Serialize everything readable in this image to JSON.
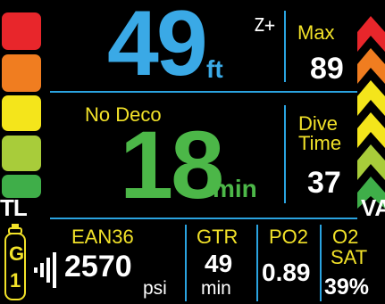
{
  "depth": {
    "value": "49",
    "unit": "ft"
  },
  "gradient_factor_indicator": "Z+",
  "max_depth": {
    "label": "Max",
    "value": "89"
  },
  "no_deco": {
    "label": "No Deco",
    "value": "18",
    "unit": "min"
  },
  "dive_time": {
    "label_line1": "Dive",
    "label_line2": "Time",
    "value": "37"
  },
  "tissue_loading": {
    "label": "TL",
    "colors": [
      "#e8262b",
      "#f07d20",
      "#f4e51b",
      "#a8cc3a",
      "#3fae49"
    ]
  },
  "vario": {
    "label": "VA",
    "colors": [
      "#e8262b",
      "#f07d20",
      "#f4e51b",
      "#f4e51b",
      "#a8cc3a",
      "#3fae49"
    ]
  },
  "gas": {
    "label": "EAN36",
    "cylinder_label_1": "G",
    "cylinder_label_2": "1",
    "pressure": "2570",
    "pressure_unit": "psi"
  },
  "gtr": {
    "label": "GTR",
    "value": "49",
    "unit": "min"
  },
  "po2": {
    "label": "PO2",
    "value": "0.89"
  },
  "o2sat": {
    "label_line1": "O2",
    "label_line2": "SAT",
    "value": "39%"
  },
  "colors": {
    "accent": "#2aa3e0",
    "depth": "#3aa9e6",
    "nodeco": "#4cb748",
    "label": "#f2e229",
    "text": "#ffffff"
  }
}
